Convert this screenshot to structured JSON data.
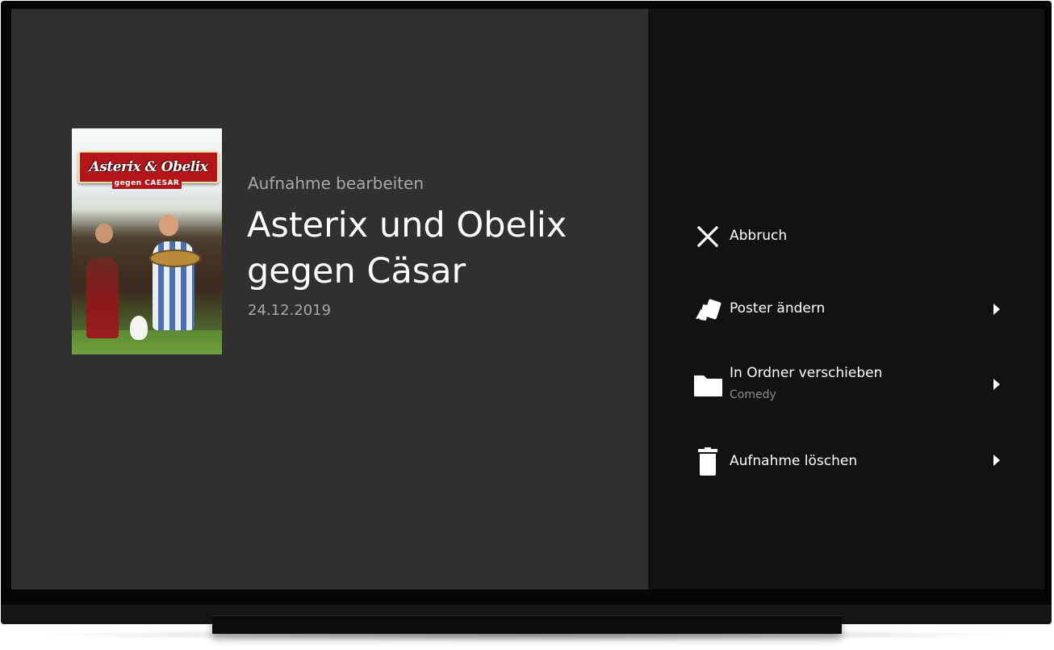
{
  "left_panel": {
    "section_label": "Aufnahme bearbeiten",
    "title_line_1": "Asterix und Obelix",
    "title_line_2": "gegen Cäsar",
    "date": "24.12.2019",
    "poster": {
      "title": "Asterix & Obelix",
      "subtitle": "gegen CAESAR"
    }
  },
  "menu": {
    "cancel": {
      "label": "Abbruch",
      "icon": "close-icon"
    },
    "change_poster": {
      "label": "Poster ändern",
      "icon": "poster-cards-icon"
    },
    "move_folder": {
      "label": "In Ordner verschieben",
      "sublabel": "Comedy",
      "icon": "folder-icon"
    },
    "delete_recording": {
      "label": "Aufnahme löschen",
      "icon": "trash-icon"
    }
  },
  "colors": {
    "left_background": "#303030",
    "right_background": "#121212",
    "text_primary": "#ffffff",
    "text_secondary": "#a8a8a8"
  }
}
